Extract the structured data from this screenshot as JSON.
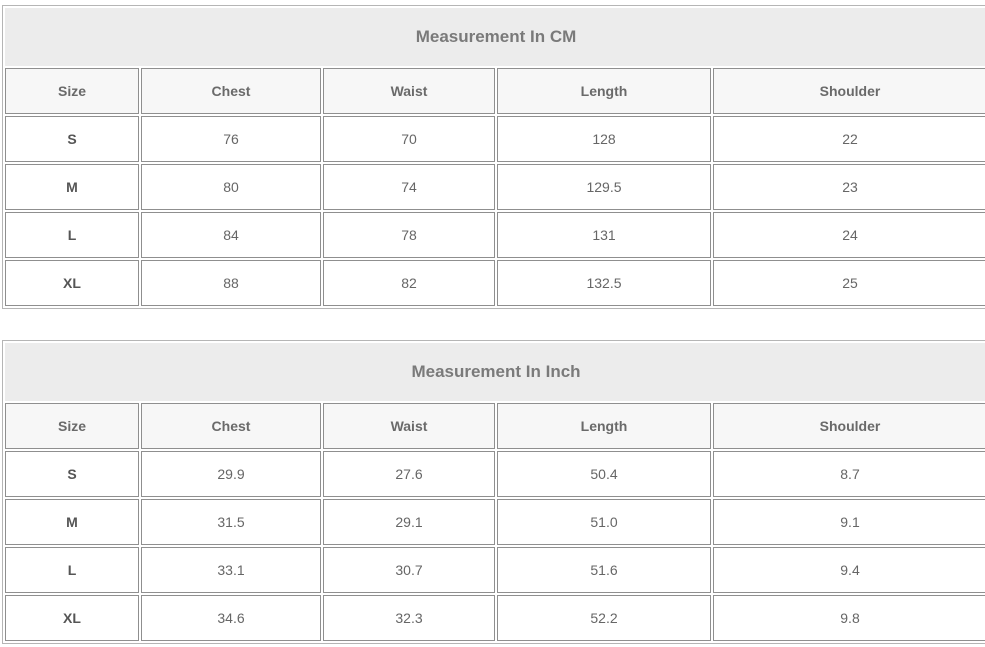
{
  "tables": [
    {
      "title": "Measurement In CM",
      "headers": [
        "Size",
        "Chest",
        "Waist",
        "Length",
        "Shoulder"
      ],
      "rows": [
        [
          "S",
          "76",
          "70",
          "128",
          "22"
        ],
        [
          "M",
          "80",
          "74",
          "129.5",
          "23"
        ],
        [
          "L",
          "84",
          "78",
          "131",
          "24"
        ],
        [
          "XL",
          "88",
          "82",
          "132.5",
          "25"
        ]
      ]
    },
    {
      "title": "Measurement In Inch",
      "headers": [
        "Size",
        "Chest",
        "Waist",
        "Length",
        "Shoulder"
      ],
      "rows": [
        [
          "S",
          "29.9",
          "27.6",
          "50.4",
          "8.7"
        ],
        [
          "M",
          "31.5",
          "29.1",
          "51.0",
          "9.1"
        ],
        [
          "L",
          "33.1",
          "30.7",
          "51.6",
          "9.4"
        ],
        [
          "XL",
          "34.6",
          "32.3",
          "52.2",
          "9.8"
        ]
      ]
    }
  ]
}
